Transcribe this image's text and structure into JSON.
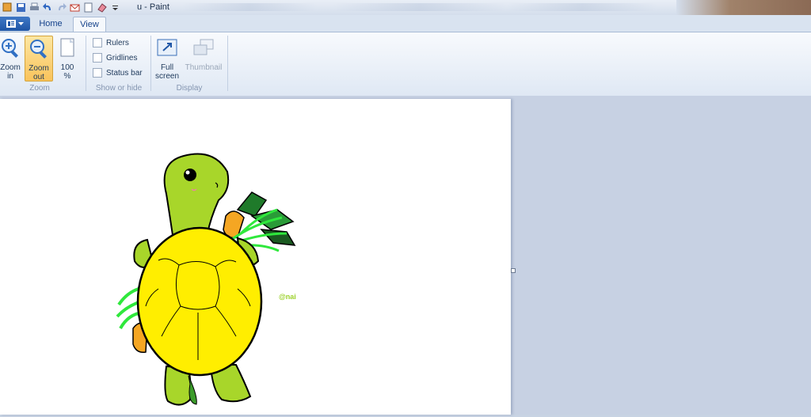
{
  "window": {
    "title": "u - Paint"
  },
  "tabs": [
    {
      "label": "Home"
    },
    {
      "label": "View"
    }
  ],
  "ribbon": {
    "zoom_group": {
      "label": "Zoom",
      "zoom_in": "Zoom in",
      "zoom_out": "Zoom out",
      "hundred": "100 %"
    },
    "show_hide_group": {
      "label": "Show or hide",
      "rulers": "Rulers",
      "gridlines": "Gridlines",
      "status_bar": "Status bar"
    },
    "display_group": {
      "label": "Display",
      "full_screen": "Full screen",
      "thumbnail": "Thumbnail"
    }
  },
  "canvas": {
    "signature": "@nai"
  },
  "colors": {
    "ribbon_active": "#f9c35b",
    "turtle_skin": "#a8d62a",
    "turtle_shell": "#ffee00",
    "carrot": "#f5a623",
    "leaves": "#2a8a2a"
  }
}
